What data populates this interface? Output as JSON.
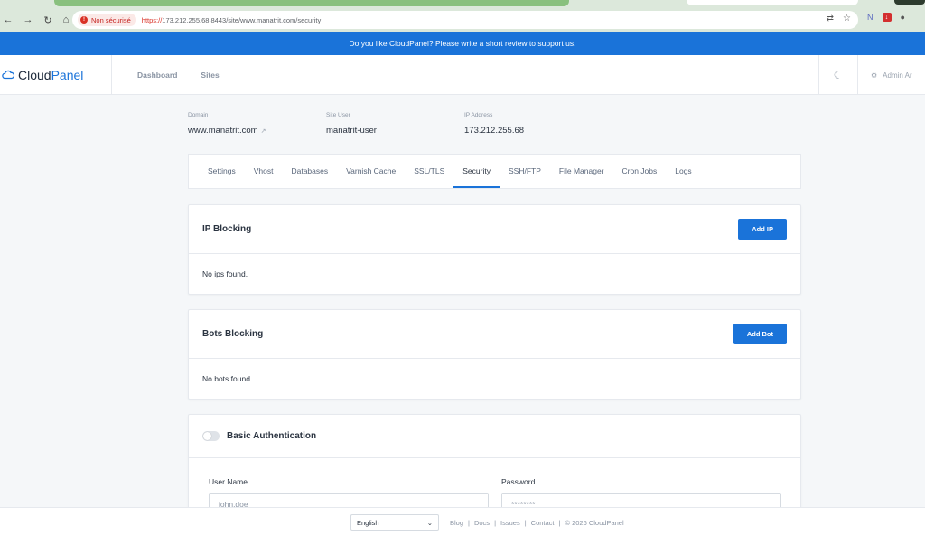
{
  "browser": {
    "security_label": "Non sécurisé",
    "url_scheme": "https://",
    "url_rest": "173.212.255.68:8443/site/www.manatrit.com/security"
  },
  "banner": {
    "text": "Do you like CloudPanel? Please write a short review to support us."
  },
  "brand": {
    "name_prefix": "Cloud",
    "name_suffix": "Panel"
  },
  "nav": {
    "dashboard": "Dashboard",
    "sites": "Sites"
  },
  "header": {
    "admin_label": "Admin Ar"
  },
  "site": {
    "domain_label": "Domain",
    "domain_value": "www.manatrit.com",
    "user_label": "Site User",
    "user_value": "manatrit-user",
    "ip_label": "IP Address",
    "ip_value": "173.212.255.68"
  },
  "tabs": [
    "Settings",
    "Vhost",
    "Databases",
    "Varnish Cache",
    "SSL/TLS",
    "Security",
    "SSH/FTP",
    "File Manager",
    "Cron Jobs",
    "Logs"
  ],
  "active_tab": "Security",
  "ip_blocking": {
    "title": "IP Blocking",
    "button": "Add IP",
    "empty": "No ips found."
  },
  "bots_blocking": {
    "title": "Bots Blocking",
    "button": "Add Bot",
    "empty": "No bots found."
  },
  "basic_auth": {
    "title": "Basic Authentication",
    "enabled": false,
    "username_label": "User Name",
    "username_placeholder": "john.doe",
    "password_label": "Password",
    "password_placeholder": "********"
  },
  "footer": {
    "language": "English",
    "links": [
      "Blog",
      "Docs",
      "Issues",
      "Contact"
    ],
    "copyright": "© 2026  CloudPanel"
  },
  "colors": {
    "accent": "#1a73d9",
    "banner": "#1a73d9"
  }
}
